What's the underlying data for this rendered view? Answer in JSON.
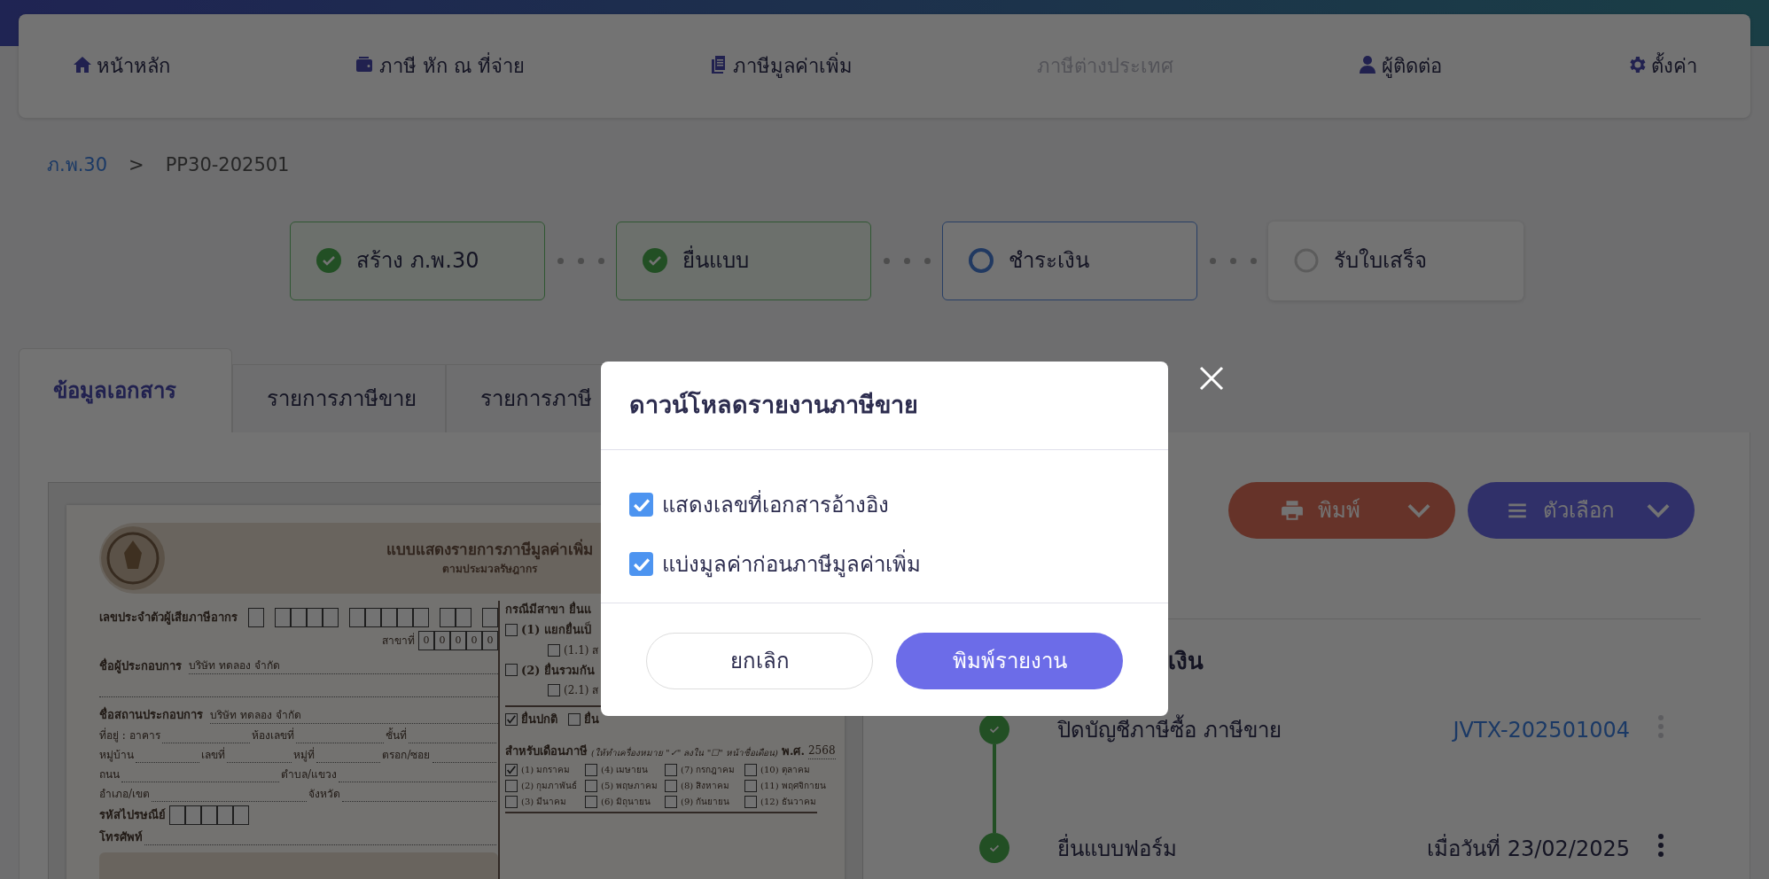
{
  "top_nav": {
    "items": [
      {
        "label": "หน้าหลัก",
        "disabled": false
      },
      {
        "label": "ภาษี หัก ณ ที่จ่าย",
        "disabled": false
      },
      {
        "label": "ภาษีมูลค่าเพิ่ม",
        "disabled": false
      },
      {
        "label": "ภาษีต่างประเทศ",
        "disabled": true
      },
      {
        "label": "ผู้ติดต่อ",
        "disabled": false
      },
      {
        "label": "ตั้งค่า",
        "disabled": false
      }
    ]
  },
  "breadcrumb": {
    "separator": ">",
    "items": [
      {
        "label": "ภ.พ.30",
        "link": true
      },
      {
        "label": "PP30-202501",
        "link": false
      }
    ]
  },
  "steps": [
    {
      "label": "สร้าง ภ.พ.30",
      "done": true,
      "current": false
    },
    {
      "label": "ยื่นแบบ",
      "done": true,
      "current": false
    },
    {
      "label": "ชำระเงิน",
      "done": false,
      "current": true
    },
    {
      "label": "รับใบเสร็จ",
      "done": false,
      "current": false
    }
  ],
  "tabs": [
    {
      "label": "ข้อมูลเอกสาร",
      "selected": true
    },
    {
      "label": "รายการภาษีขาย",
      "selected": false
    },
    {
      "label": "รายการภาษี",
      "selected": false
    }
  ],
  "document": {
    "title": "แบบแสดงรายการภาษีมูลค่าเพิ่ม",
    "subtitle": "ตามประมวลรัษฎากร",
    "tax_id_label": "เลขประจำตัวผู้เสียภาษีอากร",
    "branch_label": "สาขาที่",
    "branch_digits": [
      "0",
      "0",
      "0",
      "0",
      "0"
    ],
    "operator": {
      "label": "ชื่อผู้ประกอบการ",
      "value": "บริษัท ทดลอง จำกัด"
    },
    "establishment": {
      "label": "ชื่อสถานประกอบการ",
      "value": "บริษัท ทดลอง จำกัด"
    },
    "address_rows": [
      [
        "ที่อยู่ : อาคาร",
        "ห้องเลขที่",
        "ชั้นที่"
      ],
      [
        "หมู่บ้าน",
        "เลขที่",
        "หมู่ที่",
        "ตรอก/ซอย"
      ],
      [
        "ถนน",
        "ตำบล/แขวง"
      ],
      [
        "อำเภอ/เขต",
        "จังหวัด"
      ]
    ],
    "postcode_label": "รหัสไปรษณีย์",
    "phone_label": "โทรศัพท์",
    "branch_section": {
      "heading": "กรณีมีสาขา ยื่นแ",
      "options": [
        {
          "label": "(1) แยกยื่นเป็",
          "sub": false,
          "checked": false
        },
        {
          "label": "(1.1) ส",
          "sub": true,
          "checked": false
        },
        {
          "label": "(2) ยื่นรวมกัน",
          "sub": false,
          "checked": false
        },
        {
          "label": "(2.1) ส",
          "sub": true,
          "checked": false
        }
      ]
    },
    "filing": [
      {
        "label": "ยื่นปกติ",
        "checked": true
      },
      {
        "label": "ยื่น",
        "checked": false
      }
    ],
    "months_heading": "สำหรับเดือนภาษี",
    "months_note": "(ให้ทำเครื่องหมาย \"✓\" ลงใน \"☐\" หน้าชื่อเดือน)",
    "year_label": "พ.ศ.",
    "year": "2568",
    "months": [
      {
        "label": "(1) มกราคม",
        "checked": true
      },
      {
        "label": "(4) เมษายน",
        "checked": false
      },
      {
        "label": "(7) กรกฎาคม",
        "checked": false
      },
      {
        "label": "(10) ตุลาคม",
        "checked": false
      },
      {
        "label": "(2) กุมภาพันธ์",
        "checked": false
      },
      {
        "label": "(5) พฤษภาคม",
        "checked": false
      },
      {
        "label": "(8) สิงหาคม",
        "checked": false
      },
      {
        "label": "(11) พฤศจิกายน",
        "checked": false
      },
      {
        "label": "(3) มีนาคม",
        "checked": false
      },
      {
        "label": "(6) มิถุนายน",
        "checked": false
      },
      {
        "label": "(9) กันยายน",
        "checked": false
      },
      {
        "label": "(12) ธันวาคม",
        "checked": false
      }
    ]
  },
  "actions": [
    {
      "label": "พิมพ์",
      "kind": "print"
    },
    {
      "label": "ตัวเลือก",
      "kind": "options"
    }
  ],
  "timeline": {
    "heading": "เงิน",
    "items": [
      {
        "title": "ปิดบัญชีภาษีซื้อ ภาษีขาย",
        "meta": "JVTX-202501004",
        "link": true,
        "menu_disabled": true
      },
      {
        "title": "ยื่นแบบฟอร์ม",
        "meta": "เมื่อวันที่ 23/02/2025",
        "link": false,
        "menu_disabled": false
      }
    ]
  },
  "modal": {
    "title": "ดาวน์โหลดรายงานภาษีขาย",
    "options": [
      {
        "label": "แสดงเลขที่เอกสารอ้างอิง",
        "checked": true
      },
      {
        "label": "แบ่งมูลค่าก่อนภาษีมูลค่าเพิ่ม",
        "checked": true
      }
    ],
    "buttons": [
      {
        "label": "ยกเลิก",
        "kind": "secondary"
      },
      {
        "label": "พิมพ์รายงาน",
        "kind": "primary"
      }
    ]
  }
}
